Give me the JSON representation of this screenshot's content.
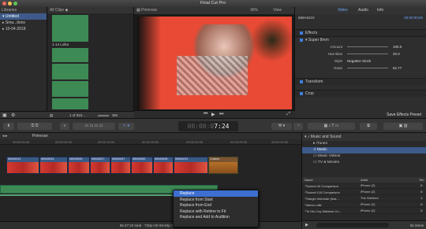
{
  "window": {
    "title": "Final Cut Pro"
  },
  "libraries": {
    "header": "Libraries",
    "items": [
      {
        "label": "Untitled",
        "selected": true
      },
      {
        "label": "Sma...tions",
        "selected": false
      },
      {
        "label": "10-04-2018",
        "selected": false
      }
    ]
  },
  "browser": {
    "header": "All Clips",
    "clip_label": "1-14 Lolita",
    "count": "1 of 910...",
    "duration": "30s"
  },
  "viewer": {
    "title": "Primrose",
    "zoom": "36%",
    "view_label": "View"
  },
  "inspector": {
    "tabs": [
      "Video",
      "Audio",
      "Info"
    ],
    "timecode": "00:00:00;00",
    "clip_name": "689A5210",
    "sections": {
      "effects": "Effects",
      "effect_name": "Super 8mm",
      "transform": "Transform",
      "crop": "Crop"
    },
    "params": [
      {
        "label": "Amount",
        "value": "100.0"
      },
      {
        "label": "Hue Bias",
        "value": "20.0"
      },
      {
        "label": "Style",
        "value": "Negative Stock"
      },
      {
        "label": "Grain",
        "value": "62.77"
      }
    ],
    "save_preset": "Save Effects Preset"
  },
  "toolbar": {
    "timecode": "7:24",
    "timecode_prefix": "00:00:0"
  },
  "timeline": {
    "project": "Primrose",
    "ruler": [
      "00:00:00:00",
      "00:00:05:00",
      "00:00:10:00",
      "00:00:15:00",
      "00:00:20:00",
      "00:00:25:00",
      "00:00:30:00"
    ],
    "video_clips": [
      "689A5242",
      "689A5634",
      "689A5626",
      "689A5627",
      "689A5647",
      "689A5650",
      "689A5638",
      "689A5231",
      "Custom"
    ],
    "audio_label": "1-14 Lolita",
    "status": "55:47:23 total · 720p HD 59.94p Stereo"
  },
  "music": {
    "header": "Music and Sound",
    "categories": [
      {
        "label": "iTunes",
        "selected": false
      },
      {
        "label": "Music",
        "selected": true
      },
      {
        "label": "Music Videos",
        "selected": false
      },
      {
        "label": "TV & Movies",
        "selected": false
      }
    ],
    "columns": [
      "Name",
      "Artist",
      "Tim"
    ],
    "tracks": [
      {
        "name": "Sonnet 40 Comparison",
        "artist": "iPhone (2)",
        "time": "0:"
      },
      {
        "name": "Sonnet 116 Comparison",
        "artist": "iPhone (2)",
        "time": "0:"
      },
      {
        "name": "Stargirl Interlude (feat....",
        "artist": "The Weeknd",
        "time": "1:"
      },
      {
        "name": "stereo-milk",
        "artist": "iPhone (2)",
        "time": "0:"
      },
      {
        "name": "To His Coy Mistress Co...",
        "artist": "iPhone (2)",
        "time": "0:"
      }
    ],
    "count": "51 items"
  },
  "context_menu": {
    "items": [
      {
        "label": "Replace",
        "selected": true
      },
      {
        "label": "Replace from Start",
        "selected": false
      },
      {
        "label": "Replace from End",
        "selected": false
      },
      {
        "label": "Replace with Retime to Fit",
        "selected": false
      },
      {
        "label": "Replace and Add to Audition",
        "selected": false
      }
    ]
  }
}
